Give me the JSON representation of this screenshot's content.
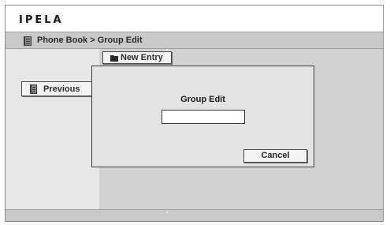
{
  "app": {
    "logo": "IPELA"
  },
  "header": {
    "breadcrumb": "Phone Book > Group Edit"
  },
  "toolbar": {
    "new_entry_label": "New Entry",
    "previous_label": "Previous"
  },
  "dialog": {
    "title": "Group Edit",
    "input_value": "",
    "input_placeholder": "",
    "cancel_label": "Cancel"
  },
  "icons": {
    "breadcrumb": "phone-book-icon",
    "new_entry": "folder-icon",
    "previous": "phone-book-icon"
  }
}
